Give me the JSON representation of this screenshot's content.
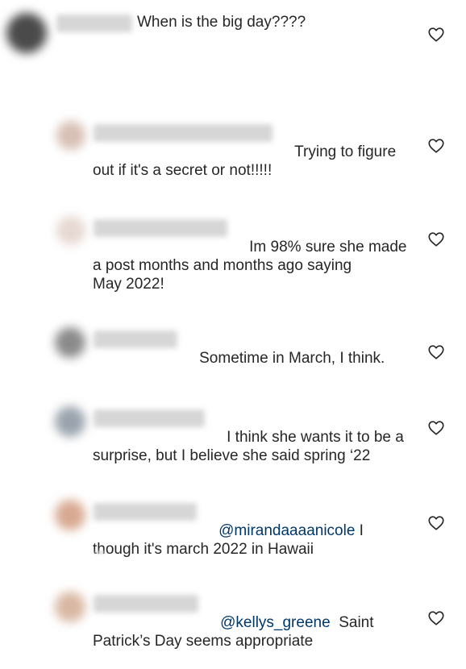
{
  "comments": [
    {
      "text": "When is the big day????",
      "avatar_color": "#4a4a4a"
    },
    {
      "text": "Trying to figure\nout if it's a secret or not!!!!!",
      "avatar_color": "#d7c0b5"
    },
    {
      "text": "Im 98% sure she made\na post months and months ago saying\nMay 2022!",
      "avatar_color": "#e6d8d2"
    },
    {
      "text": "Sometime in March, I think.",
      "avatar_color": "#8a8a8a"
    },
    {
      "text": "I think she wants it to be a\nsurprise, but I believe she said spring ‘22",
      "avatar_color": "#9aa3ad"
    },
    {
      "mention": "@mirandaaaanicole",
      "text": " I\nthough it's march 2022 in Hawaii",
      "avatar_color": "#d8a991"
    },
    {
      "mention": "@kellys_greene",
      "text": "  Saint\nPatrick’s Day seems appropriate",
      "avatar_color": "#d9b8a3"
    }
  ],
  "icons": {
    "like": "heart-outline-icon"
  },
  "colors": {
    "text": "#262626",
    "mention": "#00376b",
    "icon": "#262626"
  }
}
